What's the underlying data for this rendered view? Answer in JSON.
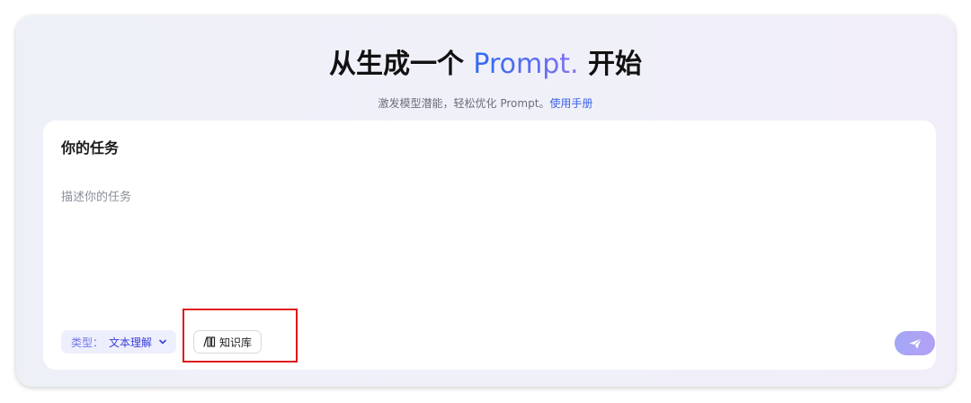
{
  "header": {
    "title_prefix": "从生成一个 ",
    "title_brand": "Prompt.",
    "title_suffix": " 开始",
    "subtitle": "激发模型潜能，轻松优化 Prompt。",
    "manual_link": "使用手册"
  },
  "task": {
    "heading": "你的任务",
    "placeholder": "描述你的任务",
    "value": ""
  },
  "toolbar": {
    "type_label": "类型：",
    "type_value": "文本理解",
    "knowledge_base_label": "知识库"
  },
  "icons": {
    "dropdown": "chevron-down-icon",
    "knowledge_base": "books-icon",
    "send": "paper-plane-icon"
  },
  "colors": {
    "brand_gradient_start": "#2f6bf2",
    "brand_gradient_end": "#8a73f0",
    "link": "#3a63e8",
    "type_chip_bg": "#eeeffc",
    "type_chip_text": "#3a3fd9",
    "send_button": "#a3a7f7",
    "highlight": "#e01818"
  }
}
